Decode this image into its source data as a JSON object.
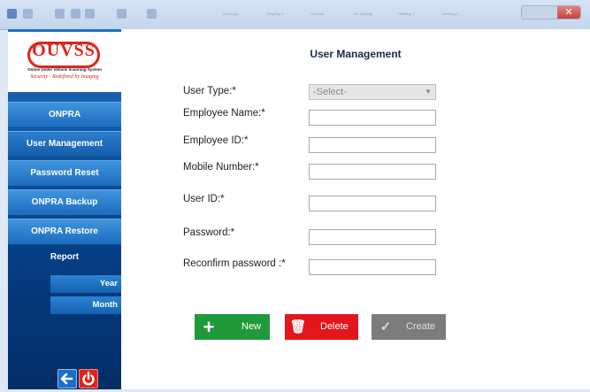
{
  "titlebar": {
    "ribbon_items": [
      "Heading 3",
      "Heading 4",
      "T Normal",
      "No Spacing",
      "Heading 1",
      "Heading 2"
    ],
    "close_glyph": "✕"
  },
  "sidebar": {
    "logo": {
      "text": "OUVSS",
      "subtitle": "Online Under Vehicle Scanning System",
      "tagline": "Security - Redefined by Imaging"
    },
    "items": [
      {
        "label": "ONPRA"
      },
      {
        "label": "User Management"
      },
      {
        "label": "Password Reset"
      },
      {
        "label": "ONPRA Backup"
      },
      {
        "label": "ONPRA Restore"
      },
      {
        "label": "Report"
      }
    ],
    "report_subitems": [
      {
        "label": "Year"
      },
      {
        "label": "Month"
      }
    ],
    "back_glyph": "🡐",
    "power_glyph": "⏻"
  },
  "main": {
    "title": "User Management",
    "form": {
      "user_type_label": "User Type:*",
      "user_type_value": "-Select-",
      "employee_name_label": "Employee Name:*",
      "employee_id_label": "Employee ID:*",
      "mobile_number_label": "Mobile Number:*",
      "user_id_label": "User ID:*",
      "password_label": "Password:*",
      "reconfirm_password_label": "Reconfirm  password :*"
    },
    "buttons": {
      "new_label": "New",
      "delete_label": "Delete",
      "create_label": "Create",
      "new_icon": "+",
      "delete_icon": "🗑",
      "create_icon": "✓"
    }
  },
  "colors": {
    "accent_blue": "#1d6cbf",
    "new_green": "#1f9a3a",
    "delete_red": "#e3161c",
    "create_gray": "#7c7c7c"
  }
}
